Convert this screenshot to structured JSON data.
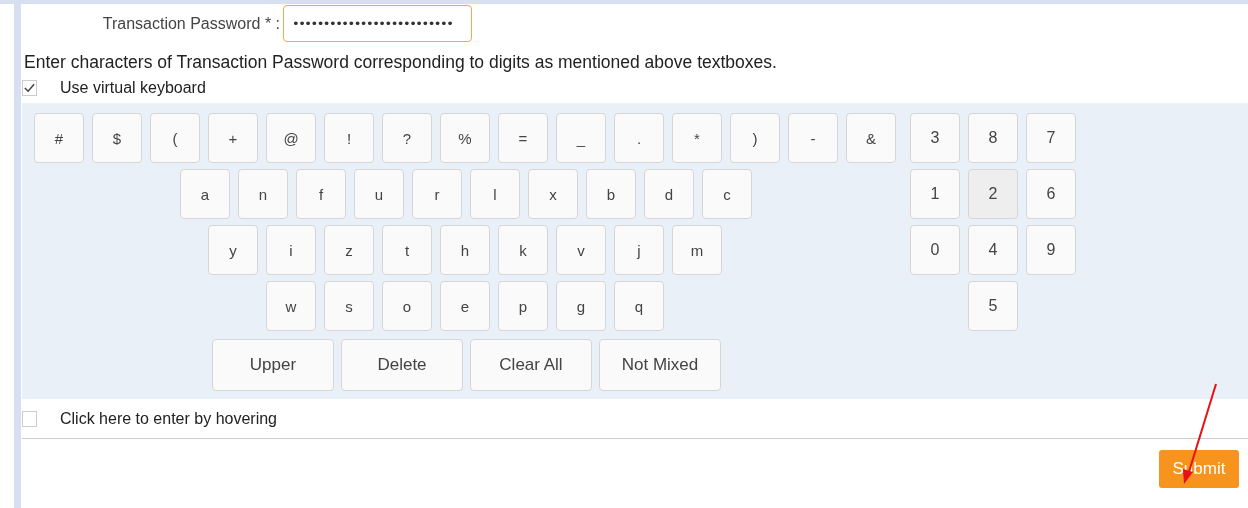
{
  "password_field": {
    "label": "Transaction Password * :",
    "value": "••••••••••••••••••••••••••"
  },
  "note": "Enter characters of Transaction Password corresponding to digits as mentioned above textboxes.",
  "virtual_keyboard_option": {
    "label": "Use virtual keyboard",
    "checked": true
  },
  "keyboard": {
    "rows": [
      {
        "keys": [
          "#",
          "$",
          "(",
          "+",
          "@",
          "!",
          "?",
          "%",
          "=",
          "_",
          ".",
          "*",
          ")",
          "-",
          "&"
        ]
      },
      {
        "keys": [
          "a",
          "n",
          "f",
          "u",
          "r",
          "l",
          "x",
          "b",
          "d",
          "c"
        ]
      },
      {
        "keys": [
          "y",
          "i",
          "z",
          "t",
          "h",
          "k",
          "v",
          "j",
          "m"
        ]
      },
      {
        "keys": [
          "w",
          "s",
          "o",
          "e",
          "p",
          "g",
          "q"
        ]
      }
    ],
    "actions": [
      "Upper",
      "Delete",
      "Clear All",
      "Not Mixed"
    ],
    "digit_rows": [
      [
        {
          "label": "3",
          "highlighted": false
        },
        {
          "label": "8",
          "highlighted": false
        },
        {
          "label": "7",
          "highlighted": false
        }
      ],
      [
        {
          "label": "1",
          "highlighted": false
        },
        {
          "label": "2",
          "highlighted": true
        },
        {
          "label": "6",
          "highlighted": false
        }
      ],
      [
        {
          "label": "0",
          "highlighted": false
        },
        {
          "label": "4",
          "highlighted": false
        },
        {
          "label": "9",
          "highlighted": false
        }
      ],
      [
        null,
        {
          "label": "5",
          "highlighted": false
        },
        null
      ]
    ]
  },
  "hover_option": {
    "label": "Click here to enter by hovering",
    "checked": false
  },
  "submit": "Submit"
}
